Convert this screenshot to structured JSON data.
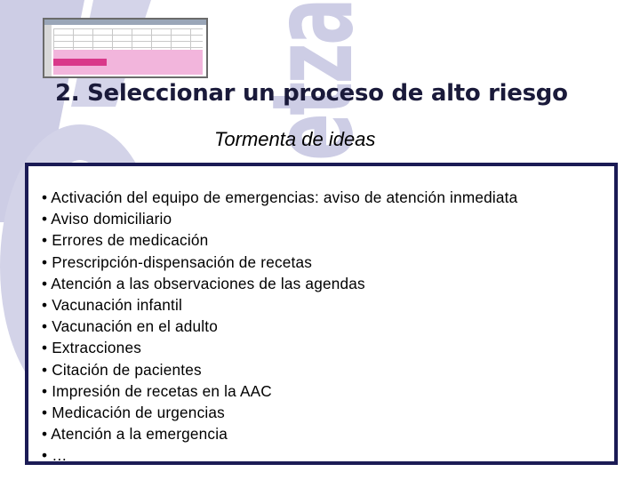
{
  "watermark": {
    "text": "Osakidetza"
  },
  "slide": {
    "title": "2. Seleccionar un proceso de alto riesgo",
    "subtitle": "Tormenta de ideas",
    "items": [
      "Activación del equipo de emergencias: aviso de atención inmediata",
      "Aviso domiciliario",
      "Errores de medicación",
      "Prescripción-dispensación de recetas",
      "Atención a las observaciones de las agendas",
      "Vacunación infantil",
      "Vacunación en el adulto",
      "Extracciones",
      "Citación de pacientes",
      "Impresión de recetas en la AAC",
      "Medicación de urgencias",
      "Atención a la emergencia",
      "…"
    ]
  },
  "colors": {
    "border": "#1b1b55",
    "watermark": "#c9c9e3",
    "title": "#1a1a3a"
  }
}
